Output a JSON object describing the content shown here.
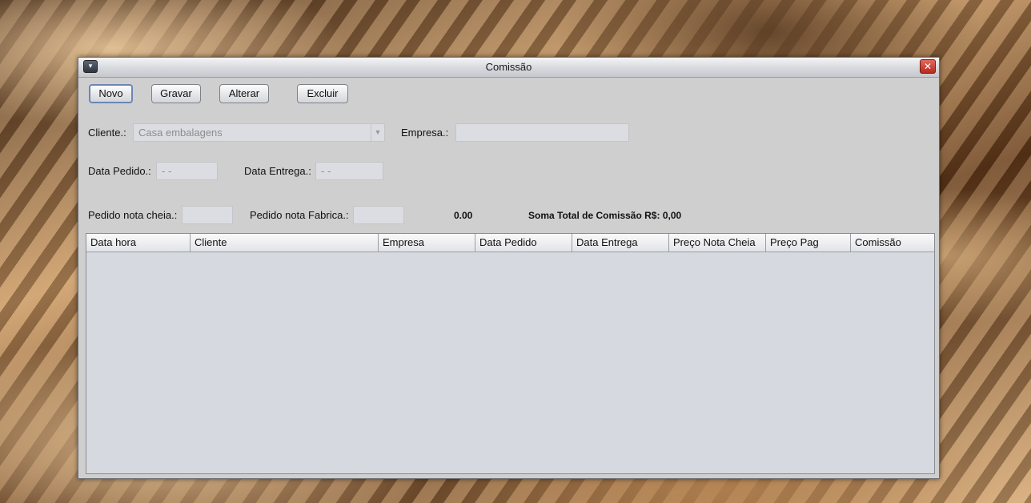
{
  "window": {
    "title": "Comissão",
    "menu_glyph": "▾",
    "close_glyph": "✕"
  },
  "toolbar": {
    "novo": "Novo",
    "gravar": "Gravar",
    "alterar": "Alterar",
    "excluir": "Excluir"
  },
  "form": {
    "cliente_label": "Cliente.:",
    "cliente_value": "Casa embalagens",
    "empresa_label": "Empresa.:",
    "empresa_value": "",
    "data_pedido_label": "Data Pedido.:",
    "data_pedido_value": "- -",
    "data_entrega_label": "Data Entrega.:",
    "data_entrega_value": "- -",
    "pedido_nota_cheia_label": "Pedido nota cheia.:",
    "pedido_nota_cheia_value": "",
    "pedido_nota_fabrica_label": "Pedido nota Fabrica.:",
    "pedido_nota_fabrica_value": "",
    "computed_value": "0.00",
    "soma_total_label": "Soma Total de Comissão R$: 0,00"
  },
  "table": {
    "columns": [
      "Data hora",
      "Cliente",
      "Empresa",
      "Data Pedido",
      "Data Entrega",
      "Preço Nota Cheia",
      "Preço Pag",
      "Comissão"
    ],
    "rows": []
  }
}
